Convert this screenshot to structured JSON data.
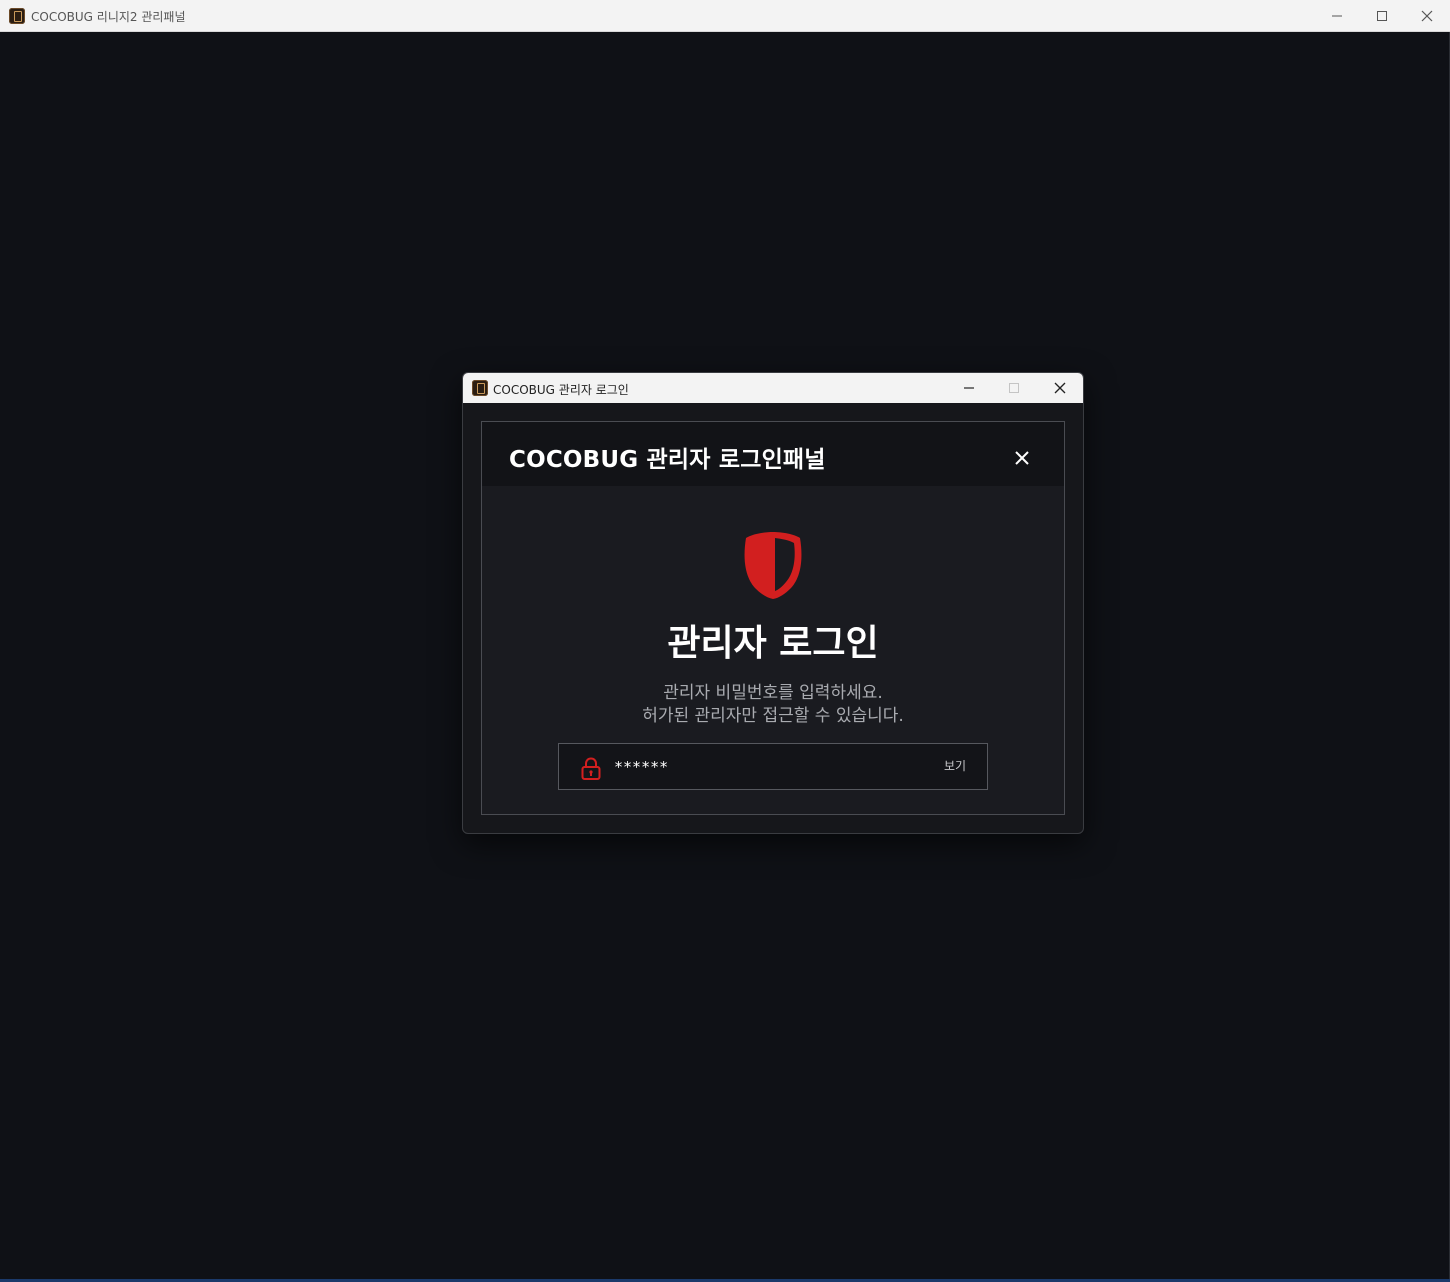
{
  "main_window": {
    "title": "COCOBUG 리니지2 관리패널",
    "icon": "app-icon"
  },
  "dialog": {
    "title": "COCOBUG 관리자 로그인",
    "panel": {
      "header_title": "COCOBUG 관리자 로그인패널",
      "shield_icon": "shield-icon",
      "heading": "관리자 로그인",
      "description_line1": "관리자 비밀번호를 입력하세요.",
      "description_line2": "허가된 관리자만 접근할 수 있습니다.",
      "password": {
        "value": "******",
        "show_label": "보기",
        "icon": "lock-icon"
      }
    }
  },
  "colors": {
    "background": "#0f1116",
    "panel": "#1a1b20",
    "accent_red": "#d21f1f",
    "text_primary": "#ffffff",
    "text_secondary": "#a9abb0"
  }
}
